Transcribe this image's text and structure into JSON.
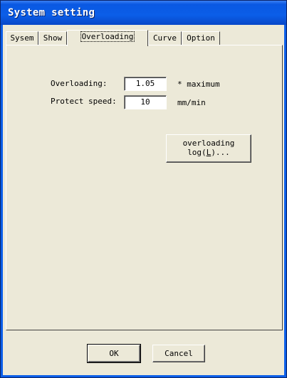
{
  "window": {
    "title": "System setting"
  },
  "tabs": [
    {
      "label": "Sysem",
      "active": false
    },
    {
      "label": "Show",
      "active": false
    },
    {
      "label": "Overloading",
      "active": true
    },
    {
      "label": "Curve",
      "active": false
    },
    {
      "label": "Option",
      "active": false
    }
  ],
  "overloading": {
    "overloading_label": "Overloading:",
    "overloading_value": "1.05",
    "overloading_unit": "* maximum",
    "protect_speed_label": "Protect speed:",
    "protect_speed_value": "10",
    "protect_speed_unit": "mm/min",
    "log_button_line1": "overloading",
    "log_button_line2_prefix": "log(",
    "log_button_mnemonic": "L",
    "log_button_line2_suffix": ")..."
  },
  "footer": {
    "ok_label": "OK",
    "cancel_label": "Cancel"
  }
}
